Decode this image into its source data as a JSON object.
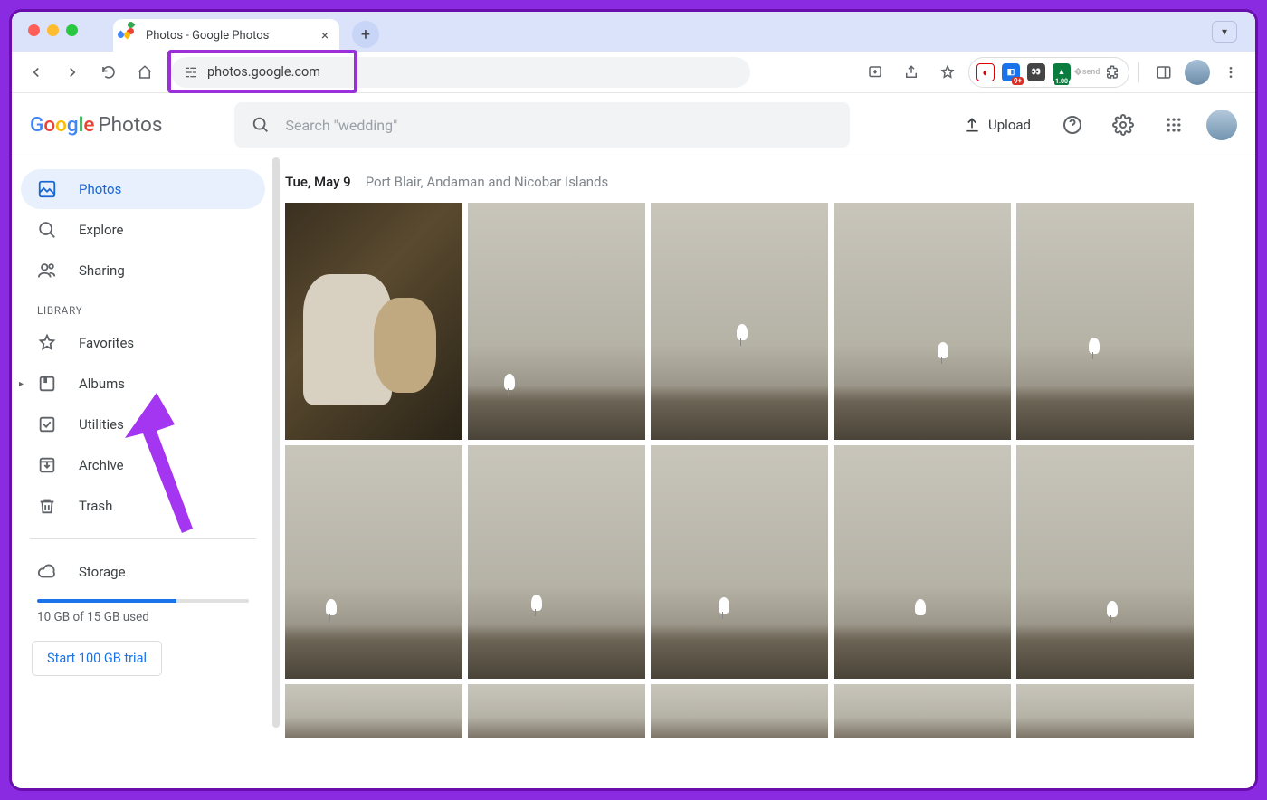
{
  "browser": {
    "tab_title": "Photos - Google Photos",
    "url": "photos.google.com",
    "extension_badge": "9+",
    "extension_badge2": "1.00"
  },
  "header": {
    "logo_suffix": "Photos",
    "search_placeholder": "Search \"wedding\"",
    "upload_label": "Upload"
  },
  "sidebar": {
    "nav": [
      {
        "label": "Photos",
        "active": true
      },
      {
        "label": "Explore"
      },
      {
        "label": "Sharing"
      }
    ],
    "library_header": "LIBRARY",
    "library": [
      {
        "label": "Favorites"
      },
      {
        "label": "Albums",
        "expandable": true
      },
      {
        "label": "Utilities"
      },
      {
        "label": "Archive"
      },
      {
        "label": "Trash"
      }
    ],
    "storage_label": "Storage",
    "storage_used_text": "10 GB of 15 GB used",
    "storage_percent": 66,
    "trial_button": "Start 100 GB trial"
  },
  "content": {
    "date": "Tue, May 9",
    "location": "Port Blair, Andaman and Nicobar Islands"
  }
}
